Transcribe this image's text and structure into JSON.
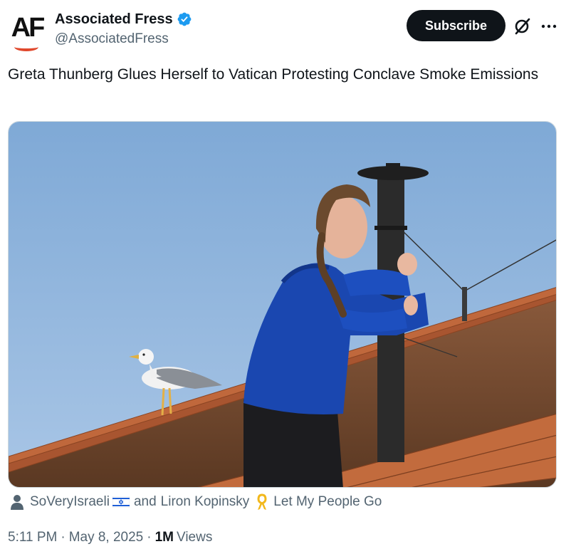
{
  "account": {
    "avatar_text": "AF",
    "name": "Associated Fress",
    "handle": "@AssociatedFress",
    "verified": true
  },
  "actions": {
    "subscribe_label": "Subscribe",
    "grok_icon": "grok-icon",
    "more_icon": "more-options-icon"
  },
  "post": {
    "text": "Greta Thunberg Glues Herself to Vatican Protesting Conclave Smoke Emissions"
  },
  "tags": {
    "user_one": "SoVeryIsraeli",
    "conjunction": "and",
    "user_two": "Liron Kopinsky",
    "slogan": "Let My People Go"
  },
  "meta": {
    "time": "5:11 PM",
    "dot": "·",
    "date": "May 8, 2025",
    "views_count": "1M",
    "views_label": "Views"
  },
  "colors": {
    "accent": "#1d9bf0",
    "text_primary": "#0f1419",
    "text_secondary": "#536471",
    "button_bg": "#0f1419"
  }
}
